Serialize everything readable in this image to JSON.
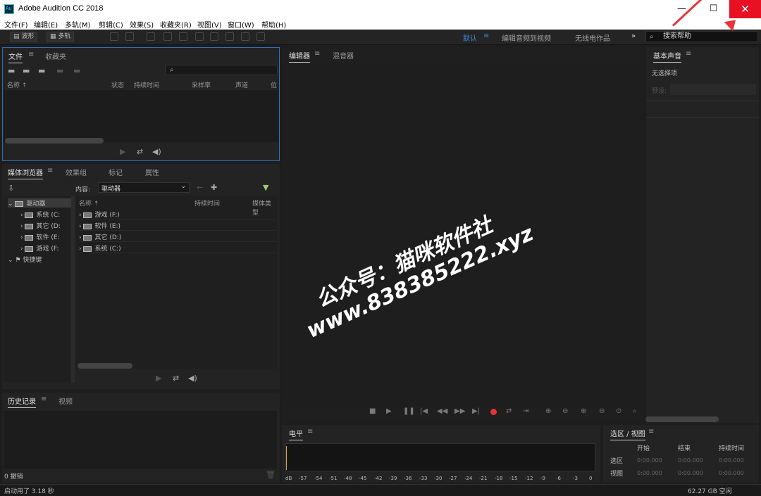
{
  "window": {
    "title": "Adobe Audition CC 2018",
    "app_icon": "Au",
    "minimize": "—",
    "maximize": "☐",
    "close": "✕"
  },
  "menu": [
    "文件(F)",
    "编辑(E)",
    "多轨(M)",
    "剪辑(C)",
    "效果(S)",
    "收藏夹(R)",
    "视图(V)",
    "窗口(W)",
    "帮助(H)"
  ],
  "toolbar": {
    "waveform": "波形",
    "multitrack": "多轨",
    "workspaces": [
      "默认",
      "编辑音频到视频",
      "无线电作品"
    ],
    "active_workspace": "默认",
    "more": "»",
    "search_placeholder": "搜索帮助"
  },
  "files_panel": {
    "tabs": [
      "文件",
      "收藏夹"
    ],
    "columns": [
      "名称",
      "状态",
      "持续时间",
      "采样率",
      "声道",
      "位"
    ],
    "search_icon": "⌕"
  },
  "media_panel": {
    "tabs": [
      "媒体浏览器",
      "效果组",
      "标记",
      "属性"
    ],
    "content_label": "内容:",
    "content_value": "驱动器",
    "tree_root": "驱动器",
    "tree_items": [
      "系统 (C:",
      "其它 (D:",
      "软件 (E:",
      "游戏 (F:"
    ],
    "shortcuts": "快捷键",
    "columns": [
      "名称",
      "持续时间",
      "媒体类型"
    ],
    "list": [
      "游戏 (F:)",
      "软件 (E:)",
      "其它 (D:)",
      "系统 (C:)"
    ]
  },
  "history_panel": {
    "tabs": [
      "历史记录",
      "视频"
    ],
    "undo": "0 撤销"
  },
  "editor": {
    "tabs": [
      "编辑器",
      "混音器"
    ]
  },
  "essential_sound": {
    "title": "基本声音",
    "no_selection": "无选择项",
    "preset_label": "预设:"
  },
  "levels": {
    "title": "电平",
    "scale": [
      "dB",
      "-57",
      "-54",
      "-51",
      "-48",
      "-45",
      "-42",
      "-39",
      "-36",
      "-33",
      "-30",
      "-27",
      "-24",
      "-21",
      "-18",
      "-15",
      "-12",
      "-9",
      "-6",
      "-3",
      "0"
    ]
  },
  "selection": {
    "title": "选区 / 视图",
    "cols": [
      "开始",
      "结束",
      "持续时间"
    ],
    "rows": [
      {
        "label": "选区",
        "values": [
          "0:00.000",
          "0:00.000",
          "0:00.000"
        ]
      },
      {
        "label": "视图",
        "values": [
          "0:00.000",
          "0:00.000",
          "0:00.000"
        ]
      }
    ]
  },
  "status": {
    "left": "启动用了 3.18 秒",
    "right": "62.27 GB 空闲"
  },
  "watermark": {
    "line1": "公众号：猫咪软件社",
    "line2": "www.838385222.xyz"
  },
  "colors": {
    "accent": "#3d8ce0",
    "close": "#e81123",
    "record": "#e8333a",
    "arrow": "#e8333a"
  }
}
